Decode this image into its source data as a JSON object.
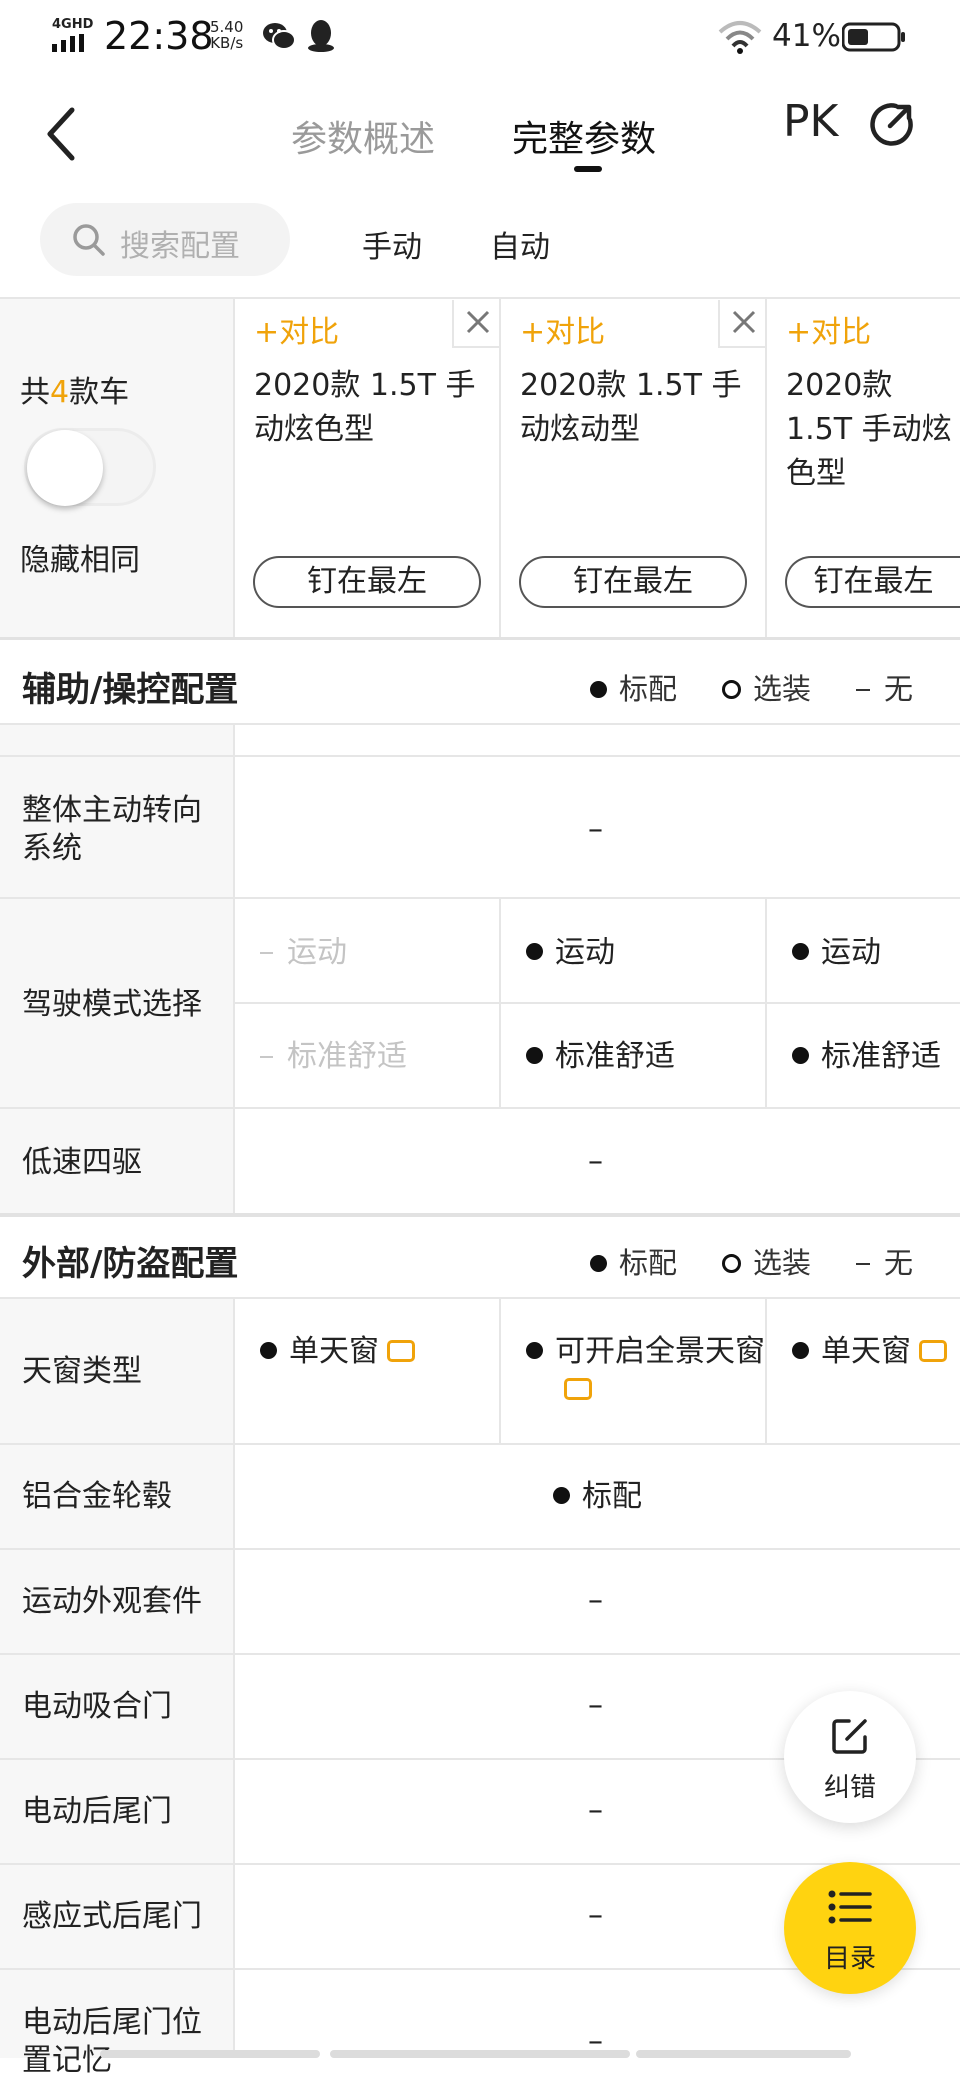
{
  "status_bar": {
    "network": "4GHD",
    "time": "22:38",
    "speed_value": "5.40",
    "speed_unit": "KB/s",
    "battery": "41%"
  },
  "nav": {
    "tabs": [
      {
        "label": "参数概述",
        "active": false
      },
      {
        "label": "完整参数",
        "active": true
      }
    ],
    "pk_label": "PK"
  },
  "search": {
    "placeholder": "搜索配置"
  },
  "filters": [
    "手动",
    "自动"
  ],
  "header": {
    "total_prefix": "共",
    "total_count": "4",
    "total_suffix": "款车",
    "hide_same_label": "隐藏相同",
    "add_compare": "+对比",
    "pin_label": "钉在最左",
    "models": [
      "2020款 1.5T 手动炫色型",
      "2020款 1.5T 手动炫动型",
      "2020款 1.5T 手动炫色型"
    ]
  },
  "legend": {
    "standard": "标配",
    "optional": "选装",
    "none": "无"
  },
  "sections": [
    {
      "title": "辅助/操控配置",
      "rows": [
        {
          "label": "整体主动转向系统",
          "value": "–"
        },
        {
          "label": "驾驶模式选择",
          "subrows": [
            {
              "values": [
                "运动",
                "运动",
                "运动"
              ],
              "available": [
                false,
                true,
                true
              ]
            },
            {
              "values": [
                "标准舒适",
                "标准舒适",
                "标准舒适"
              ],
              "available": [
                false,
                true,
                true
              ]
            }
          ]
        },
        {
          "label": "低速四驱",
          "value": "–"
        }
      ]
    },
    {
      "title": "外部/防盗配置",
      "rows": [
        {
          "label": "天窗类型",
          "values": [
            "单天窗",
            "可开启全景天窗",
            "单天窗"
          ]
        },
        {
          "label": "铝合金轮毂",
          "value": "标配"
        },
        {
          "label": "运动外观套件",
          "value": "–"
        },
        {
          "label": "电动吸合门",
          "value": "–"
        },
        {
          "label": "电动后尾门",
          "value": "–"
        },
        {
          "label": "感应式后尾门",
          "value": "–"
        },
        {
          "label": "电动后尾门位置记忆",
          "value": "–"
        }
      ]
    }
  ],
  "fabs": {
    "correct_label": "纠错",
    "toc_label": "目录"
  },
  "colors": {
    "accent": "#f0a30a",
    "fab_yellow": "#ffd310",
    "gray_bg": "#f7f7f7"
  }
}
